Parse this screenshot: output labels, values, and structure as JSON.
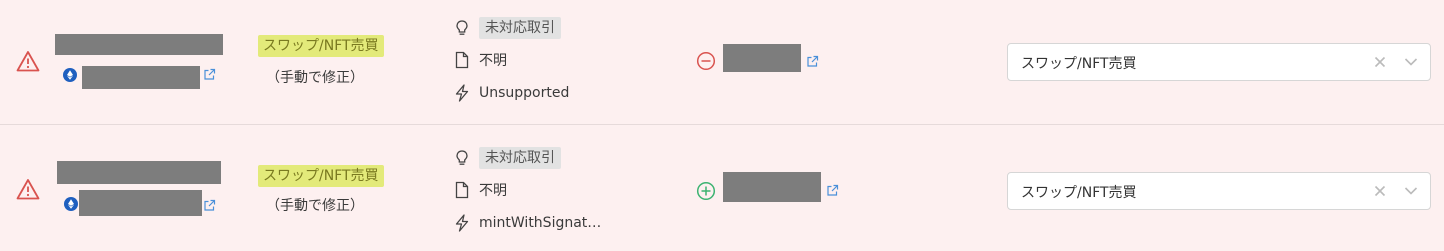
{
  "rows": [
    {
      "category_badge": "スワップ/NFT売買",
      "category_note": "（手動で修正）",
      "status_tag": "未対応取引",
      "document_label": "不明",
      "function_label": "Unsupported",
      "direction": "outgoing",
      "select_value": "スワップ/NFT売買",
      "colors": {
        "direction": "#d9534f"
      }
    },
    {
      "category_badge": "スワップ/NFT売買",
      "category_note": "（手動で修正）",
      "status_tag": "未対応取引",
      "document_label": "不明",
      "function_label": "mintWithSignat…",
      "direction": "incoming",
      "select_value": "スワップ/NFT売買",
      "colors": {
        "direction": "#3cb371"
      }
    }
  ],
  "icons": {
    "warning": "warning-triangle-icon",
    "chain": "ethereum-icon",
    "external_link": "external-link-icon",
    "status": "lightbulb-icon",
    "document": "document-icon",
    "function": "lightning-icon",
    "outgoing": "minus-circle-icon",
    "incoming": "plus-circle-icon",
    "clear": "clear-x-icon",
    "dropdown": "chevron-down-icon"
  },
  "colors": {
    "row_background": "#fdf0f0",
    "badge_background": "#e3ea7a",
    "warning": "#d9534f",
    "link": "#4a90d9",
    "redaction": "#7d7d7d"
  }
}
